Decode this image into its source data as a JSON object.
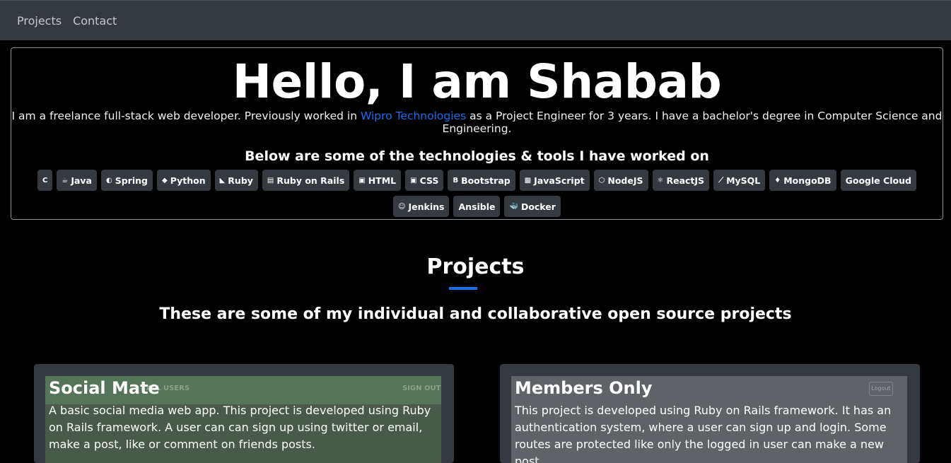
{
  "nav": {
    "items": [
      {
        "label": "Projects"
      },
      {
        "label": "Contact"
      }
    ]
  },
  "hero": {
    "title": "Hello, I am Shabab",
    "intro_before": "I am a freelance full-stack web developer. Previously worked in ",
    "intro_link": "Wipro Technologies",
    "intro_after": " as a Project Engineer for 3 years. I have a bachelor's degree in Computer Science and Engineering.",
    "tech_heading": "Below are some of the technologies & tools I have worked on"
  },
  "technologies": [
    {
      "label": "",
      "icon": "c-icon",
      "glyph": "C"
    },
    {
      "label": "Java",
      "icon": "java-icon",
      "glyph": "☕"
    },
    {
      "label": "Spring",
      "icon": "spring-icon",
      "glyph": "◐"
    },
    {
      "label": "Python",
      "icon": "python-icon",
      "glyph": "◆"
    },
    {
      "label": "Ruby",
      "icon": "ruby-icon",
      "glyph": "◣"
    },
    {
      "label": "Ruby on Rails",
      "icon": "rails-icon",
      "glyph": "▤"
    },
    {
      "label": "HTML",
      "icon": "html-icon",
      "glyph": "▣"
    },
    {
      "label": "CSS",
      "icon": "css-icon",
      "glyph": "▣"
    },
    {
      "label": "Bootstrap",
      "icon": "bootstrap-icon",
      "glyph": "B"
    },
    {
      "label": "JavaScript",
      "icon": "javascript-icon",
      "glyph": "▩"
    },
    {
      "label": "NodeJS",
      "icon": "nodejs-icon",
      "glyph": "⬡"
    },
    {
      "label": "ReactJS",
      "icon": "reactjs-icon",
      "glyph": "⚛"
    },
    {
      "label": "MySQL",
      "icon": "mysql-icon",
      "glyph": "⟋"
    },
    {
      "label": "MongoDB",
      "icon": "mongodb-icon",
      "glyph": "♦"
    },
    {
      "label": "Google Cloud",
      "icon": "",
      "glyph": ""
    },
    {
      "label": "Jenkins",
      "icon": "jenkins-icon",
      "glyph": "☺"
    },
    {
      "label": "Ansible",
      "icon": "",
      "glyph": ""
    },
    {
      "label": "Docker",
      "icon": "docker-icon",
      "glyph": "🐳"
    }
  ],
  "projects": {
    "title": "Projects",
    "subtitle": "These are some of my individual and collaborative open source projects",
    "cards": [
      {
        "title": "Social Mate",
        "text": "A basic social media web app. This project is developed using Ruby on Rails framework. A user can can sign up using twitter or email, make a post, like or comment on friends posts.",
        "ghost_left": "ALL USERS",
        "ghost_right": "SIGN OUT"
      },
      {
        "title": "Members Only",
        "text": "This project is developed using Ruby on Rails framework. It has an authentication system, where a user can sign up and login. Some routes are protected like only the logged in user can make a new post.",
        "ghost_button": "Logout"
      }
    ]
  },
  "colors": {
    "navbar": "#343a40",
    "accent": "#1a6cf0",
    "badge": "#343a40"
  }
}
